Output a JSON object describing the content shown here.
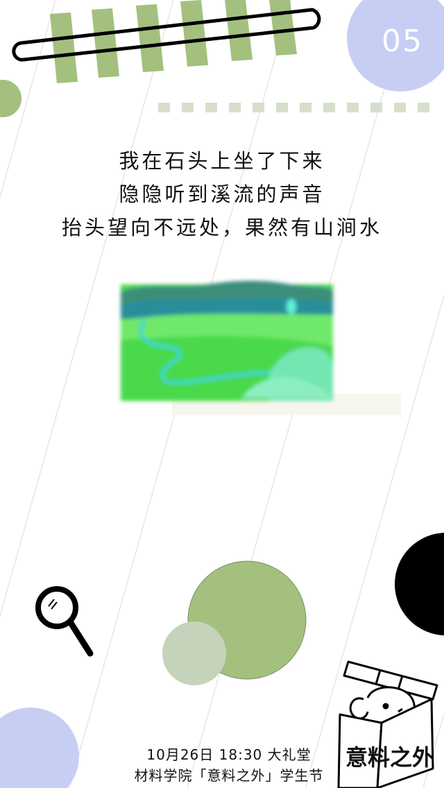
{
  "page_number": "05",
  "poem": {
    "lines": [
      "我在石头上坐了下来",
      "隐隐听到溪流的声音",
      "抬头望向不远处，果然有山涧水"
    ]
  },
  "footer": {
    "event_line": "10月26日    18:30    大礼堂",
    "organizer_line": "材料学院「意料之外」学生节"
  },
  "brand_text": "意料之外",
  "colors": {
    "green": "#a3c07e",
    "sage": "#c5d3bb",
    "lavender": "#c6cef4",
    "dash": "#d6dfcc",
    "black": "#000000"
  },
  "icons": [
    "magnifier-icon",
    "elephant-box-icon"
  ]
}
